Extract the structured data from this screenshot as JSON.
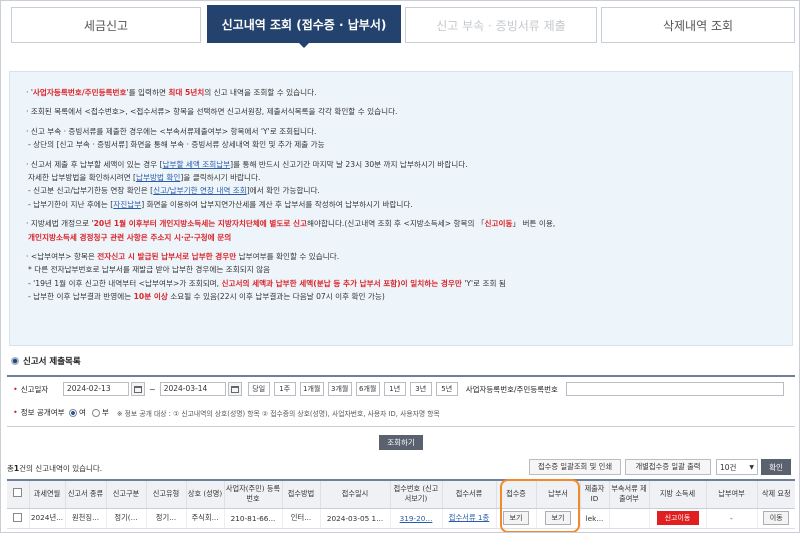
{
  "tabs": [
    {
      "label": "세금신고",
      "state": "normal"
    },
    {
      "label": "신고내역 조회 (접수증 · 납부서)",
      "state": "active"
    },
    {
      "label": "신고 부속 · 증빙서류 제출",
      "state": "disabled"
    },
    {
      "label": "삭제내역 조회",
      "state": "normal"
    }
  ],
  "info": {
    "g1_l1": {
      "p1": "· '",
      "hl": "사업자등록번호/주민등록번호",
      "p2": "'를 입력하면 ",
      "hl2": "최대 5년치",
      "p3": "의 신고 내역을 조회할 수 있습니다."
    },
    "g2_l1": "· 조회된 목록에서 <접수번호>, <접수서류> 항목을 선택하면 신고서원장, 제출서식목록을 각각 확인할 수 있습니다.",
    "g3_l1": "· 신고 부속 · 증빙서류를 제출한 경우에는 <부속서류제출여부> 항목에서 'Y'로 조회됩니다.",
    "g3_l2": "- 상단의 [신고 부속 · 증빙서류] 화면을 통해 부속 · 증빙서류 상세내역 확인 및 추가 제출 가능",
    "g4_l1": {
      "p1": "· 신고서 제출 후 납부할 세액이 있는 경우 [",
      "link": "납부할 세액 조회납부",
      "p2": "]를 통해 반드시 신고기간 마지막 날 23시 30분 까지 납부하시기 바랍니다."
    },
    "g4_l2": {
      "p1": "자세한 납부방법을 확인하시려면 [",
      "link": "납부방법 확인",
      "p2": "]을 클릭하시기 바랍니다."
    },
    "g4_l3": {
      "p1": "- 신고분 신고/납부기한등 연장 확인은 [",
      "link": "신고/납부기한 연장 내역 조회",
      "p2": "]에서 확인 가능합니다."
    },
    "g4_l4": {
      "p1": "- 납부기한이 지난 후에는 [",
      "link": "자진납부",
      "p2": "] 화면을 이용하여 납부지연가산세를 계산 후 납부서를 작성하여 납부하시기 바랍니다."
    },
    "g5_l1": {
      "p1": "· 지방세법 개정으로 '",
      "hl": "20년 1월 이후부터 개인지방소득세는 지방자치단체에 별도로 신고",
      "p2": "해야합니다.(신고내역 조회 후 <지방소득세> 항목의 「",
      "hl2": "신고이동",
      "p3": "」 버튼 이용,"
    },
    "g5_l2": "개인지방소득세 경정청구 관련 사항은 주소지 시·군·구청에 문의",
    "g6_l1": {
      "p1": "· <납부여부> 항목은 ",
      "hl": "전자신고 시 발급된 납부서로 납부한 경우만",
      "p2": " 납부여부를 확인할 수 있습니다."
    },
    "g6_l2": "* 다른 전자납부번호로 납부서를 재발급 받아 납부한 경우에는 조회되지 않음",
    "g6_l3": {
      "p1": "- '19년 1월 이후 신고한 내역부터 <납부여부>가 조회되며, ",
      "hl": "신고서의 세액과 납부한 세액(분납 등 추가 납부서 포함)이 일치하는 경우만",
      "p2": " 'Y'로 조회 됨"
    },
    "g6_l4": {
      "p1": "- 납부한 이후 납부결과 반영에는 ",
      "hl": "10분 이상",
      "p2": " 소요될 수 있음(22시 이후 납부결과는 다음날 07시 이후 확인 가능)"
    }
  },
  "section_title": "신고서 제출목록",
  "search": {
    "date_label": "신고일자",
    "date_from": "2024-02-13",
    "date_to": "2024-03-14",
    "period_buttons": [
      "당일",
      "1주",
      "1개월",
      "3개월",
      "6개월",
      "1년",
      "3년",
      "5년"
    ],
    "id_label": "사업자등록번호/주민등록번호",
    "disclosure_label": "정보 공개여부",
    "yes": "여",
    "no": "부",
    "note": "※ 정보 공개 대상 : ① 신고내역의 상호(성명) 항목 ② 접수증의 상호(성명), 사업자번호, 사용자 ID, 사용자명 항목",
    "query_button": "조회하기"
  },
  "result": {
    "count_prefix": "총",
    "count": "1",
    "count_suffix": "건의 신고내역이 있습니다.",
    "bulk_btn": "접수증 일괄조회 및 인쇄",
    "each_btn": "개별접수증 일괄 출력",
    "page_size": "10건",
    "print_btn": "확인"
  },
  "table": {
    "headers": [
      "",
      "과세연월",
      "신고서 종류",
      "신고구분",
      "신고유형",
      "상호 (성명)",
      "사업자(주민) 등록번호",
      "접수방법",
      "접수일시",
      "접수번호 (신고서보기)",
      "접수서류",
      "접수증",
      "납부서",
      "제출자 ID",
      "부속서류 제출여부",
      "지방 소득세",
      "납부여부",
      "삭제 요청"
    ],
    "row": {
      "period": "2024년...",
      "type": "원천징...",
      "division": "정기(...",
      "kind": "정기...",
      "name": "주식회...",
      "reg_no": "210-81-66...",
      "method": "인터...",
      "datetime": "2024-03-05 1...",
      "receipt_no": "319-20...",
      "docs": "접수서류 1종",
      "receipt": "보기",
      "bill": "보기",
      "submitter": "lek...",
      "attach": "",
      "local_tax": "신고이동",
      "paid": "-",
      "delete": "이동"
    }
  },
  "colors": {
    "navy": "#23426e",
    "red": "#d8242a",
    "link": "#2a5cab",
    "highlight": "#f08a2c"
  }
}
